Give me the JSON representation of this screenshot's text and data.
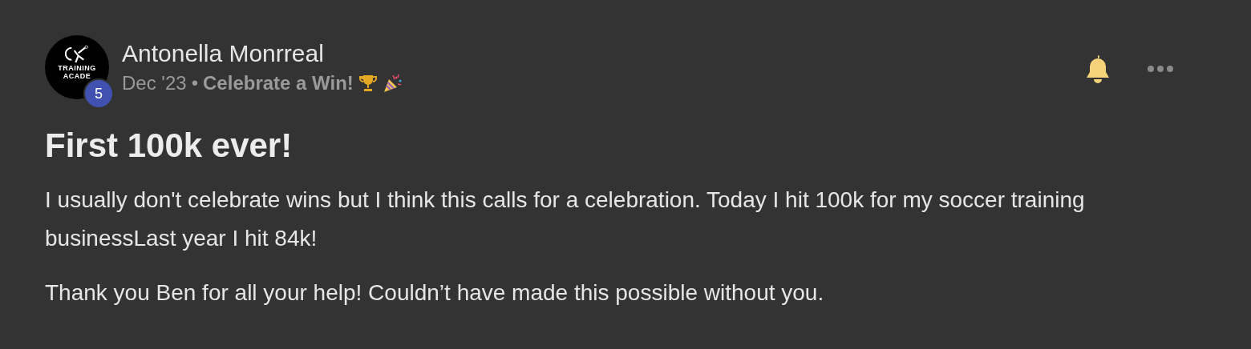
{
  "post": {
    "author": {
      "name": "Antonella Monrreal",
      "avatar_text": [
        "TRAINING",
        "ACADE"
      ],
      "level": "5"
    },
    "date": "Dec '23",
    "separator": "•",
    "category": "Celebrate a Win!",
    "subscribed": true,
    "title": "First 100k ever!",
    "paragraphs": [
      "I usually don't celebrate wins but I think this calls for a celebration. Today I hit 100k for my soccer training businessLast year I hit 84k!",
      "Thank you Ben for all your help! Couldn’t have made this possible without you."
    ]
  }
}
